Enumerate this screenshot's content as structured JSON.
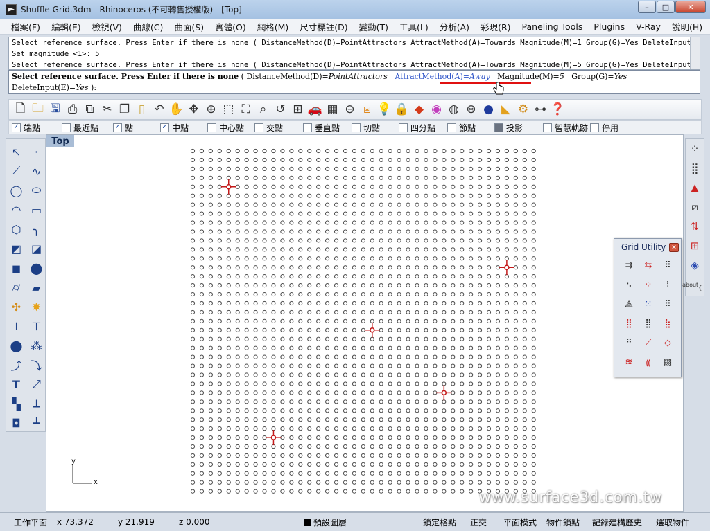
{
  "window": {
    "title": "Shuffle Grid.3dm - Rhinoceros (不可轉售授權版) - [Top]",
    "min_label": "–",
    "max_label": "□",
    "close_label": "✕"
  },
  "menu": [
    "檔案(F)",
    "編輯(E)",
    "檢視(V)",
    "曲線(C)",
    "曲面(S)",
    "實體(O)",
    "網格(M)",
    "尺寸標註(D)",
    "變動(T)",
    "工具(L)",
    "分析(A)",
    "彩現(R)",
    "Paneling Tools",
    "Plugins",
    "V-Ray",
    "說明(H)"
  ],
  "command_history": [
    "Select reference surface. Press Enter if there is none ( DistanceMethod(D)=PointAttractors  AttractMethod(A)=Towards  Magnitude(M)=1  Group(G)=Yes  DeleteInput(E)=Y",
    "Set magnitude <1>: 5",
    "Select reference surface. Press Enter if there is none ( DistanceMethod(D)=PointAttractors  AttractMethod(A)=Towards  Magnitude(M)=5  Group(G)=Yes  DeleteInput(E)=Y"
  ],
  "command_prompt": {
    "lead": "Select reference surface. Press Enter if there is none",
    "open_paren": " ( ",
    "opt1_name": "DistanceMethod(D)=",
    "opt1_value": "PointAttractors",
    "opt2_name": "AttractMethod(A)=",
    "opt2_value": "Away",
    "opt3_name": "Magnitude(M)=",
    "opt3_value": "5",
    "opt4_name": "Group(G)=",
    "opt4_value": "Yes",
    "opt5_name": "DeleteInput(E)=",
    "opt5_value": "Yes",
    "close": " ):"
  },
  "osnaps": [
    {
      "label": "端點",
      "checked": true
    },
    {
      "label": "最近點",
      "checked": false
    },
    {
      "label": "點",
      "checked": true
    },
    {
      "label": "中點",
      "checked": true
    },
    {
      "label": "中心點",
      "checked": false
    },
    {
      "label": "交點",
      "checked": false
    },
    {
      "label": "垂直點",
      "checked": false
    },
    {
      "label": "切點",
      "checked": false
    },
    {
      "label": "四分點",
      "checked": false
    },
    {
      "label": "節點",
      "checked": false
    },
    {
      "label": "投影",
      "checked": false,
      "dark": true
    },
    {
      "label": "智慧軌跡",
      "checked": false
    },
    {
      "label": "停用",
      "checked": false
    }
  ],
  "viewport": {
    "name": "Top",
    "axis_x": "x",
    "axis_y": "y",
    "watermark": "www.surface3d.com.tw",
    "grid": {
      "cols": 39,
      "rows": 39
    },
    "attractors": [
      {
        "col": 4,
        "row": 4
      },
      {
        "col": 35,
        "row": 13
      },
      {
        "col": 20,
        "row": 20
      },
      {
        "col": 28,
        "row": 27
      },
      {
        "col": 9,
        "row": 32
      }
    ]
  },
  "grid_utility": {
    "title": "Grid Utility",
    "close": "✕"
  },
  "right_tools": {
    "about_label": "about"
  },
  "statusbar": {
    "cplane": "工作平面",
    "x": "x 73.372",
    "y": "y 21.919",
    "z": "z 0.000",
    "layer": "預設圖層",
    "grid_snap": "鎖定格點",
    "ortho": "正交",
    "planar": "平面模式",
    "osnap": "物件鎖點",
    "history": "記錄建構歷史",
    "filter": "選取物件"
  }
}
